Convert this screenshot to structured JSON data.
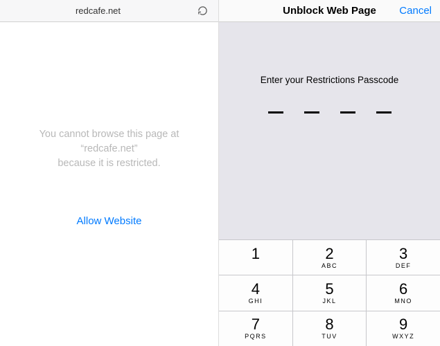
{
  "browser": {
    "url": "redcafe.net"
  },
  "restricted": {
    "line1": "You cannot browse this page at",
    "line2": "“redcafe.net”",
    "line3": "because it is restricted.",
    "allow_label": "Allow Website"
  },
  "passcode_dialog": {
    "title": "Unblock Web Page",
    "cancel_label": "Cancel",
    "prompt": "Enter your Restrictions Passcode"
  },
  "keypad": {
    "keys": [
      {
        "digit": "1",
        "letters": ""
      },
      {
        "digit": "2",
        "letters": "ABC"
      },
      {
        "digit": "3",
        "letters": "DEF"
      },
      {
        "digit": "4",
        "letters": "GHI"
      },
      {
        "digit": "5",
        "letters": "JKL"
      },
      {
        "digit": "6",
        "letters": "MNO"
      },
      {
        "digit": "7",
        "letters": "PQRS"
      },
      {
        "digit": "8",
        "letters": "TUV"
      },
      {
        "digit": "9",
        "letters": "WXYZ"
      }
    ]
  },
  "colors": {
    "accent": "#007aff",
    "keypad_bg": "#e6e5eb"
  }
}
